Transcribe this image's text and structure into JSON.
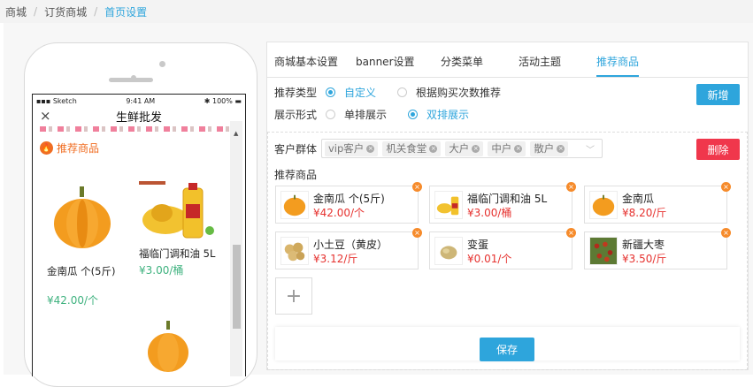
{
  "breadcrumb": [
    "商城",
    "订货商城",
    "首页设置"
  ],
  "phone": {
    "status_carrier": "Sketch",
    "status_time": "9:41 AM",
    "status_battery": "100%",
    "title": "生鲜批发",
    "section_title": "推荐商品",
    "products": [
      {
        "name": "金南瓜 个(5斤)",
        "price": "¥42.00/个"
      },
      {
        "name": "福临门调和油 5L",
        "price": "¥3.00/桶"
      }
    ]
  },
  "tabs": [
    "商城基本设置",
    "banner设置",
    "分类菜单",
    "活动主题",
    "推荐商品"
  ],
  "form": {
    "type_label": "推荐类型",
    "type_options": [
      "自定义",
      "根据购买次数推荐"
    ],
    "display_label": "展示形式",
    "display_options": [
      "单排展示",
      "双排展示"
    ],
    "add_button": "新增",
    "customer_label": "客户群体",
    "customer_tags": [
      "vip客户",
      "机关食堂",
      "大户",
      "中户",
      "散户"
    ],
    "delete_button": "删除",
    "goods_label": "推荐商品",
    "goods": [
      {
        "name": "金南瓜 个(5斤)",
        "price": "¥42.00/个"
      },
      {
        "name": "福临门调和油 5L",
        "price": "¥3.00/桶"
      },
      {
        "name": "金南瓜",
        "price": "¥8.20/斤"
      },
      {
        "name": "小土豆（黄皮）",
        "price": "¥3.12/斤"
      },
      {
        "name": "变蛋",
        "price": "¥0.01/个"
      },
      {
        "name": "新疆大枣",
        "price": "¥3.50/斤"
      }
    ],
    "add_goods_symbol": "+",
    "save_button": "保存"
  },
  "colors": {
    "accent": "#2ea5dc",
    "danger": "#f0374c",
    "price": "#e6322f",
    "orange": "#f06d22"
  }
}
